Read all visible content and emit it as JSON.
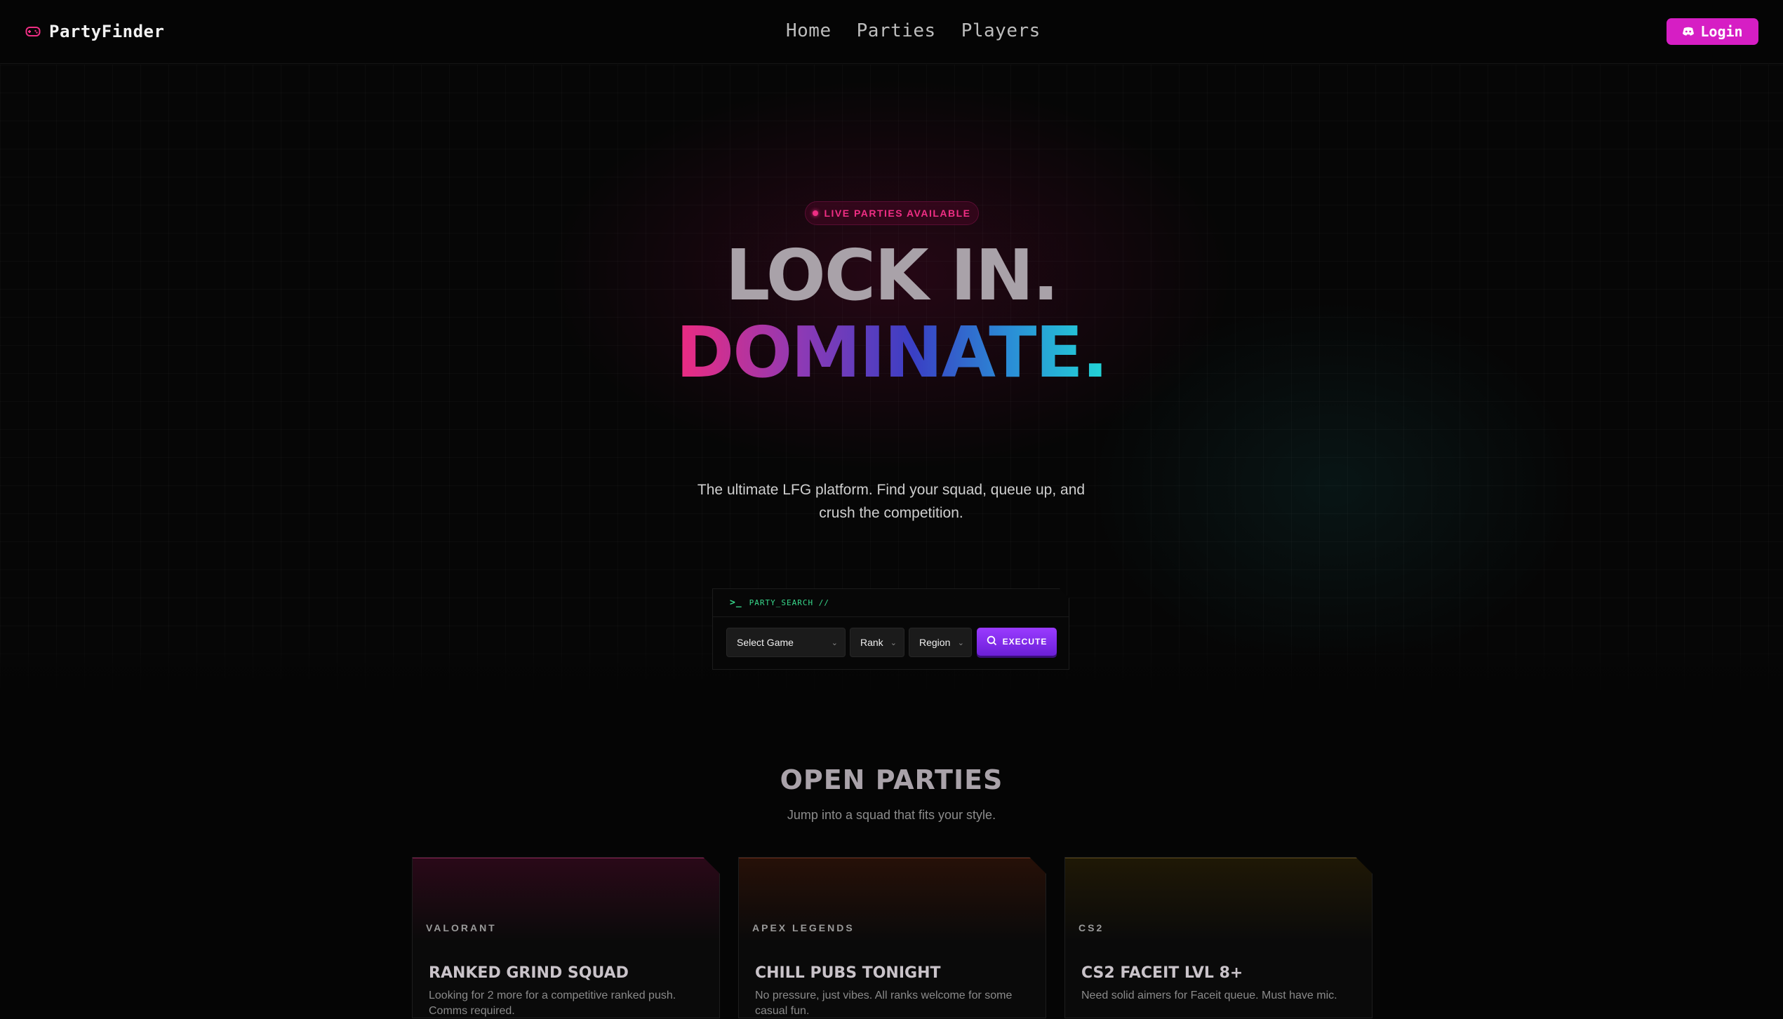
{
  "nav": {
    "brand": "PartyFinder",
    "links": [
      "Home",
      "Parties",
      "Players"
    ],
    "login_label": "Login"
  },
  "hero": {
    "badge": "LIVE PARTIES AVAILABLE",
    "headline_line1": "LOCK IN.",
    "headline_line2": "DOMINATE.",
    "subtitle": "The ultimate LFG platform. Find your squad, queue up, and crush the competition."
  },
  "search": {
    "prompt": ">_",
    "label": "PARTY_SEARCH //",
    "game_select": "Select Game",
    "rank_select": "Rank",
    "region_select": "Region",
    "execute_label": "EXECUTE"
  },
  "parties": {
    "title": "OPEN PARTIES",
    "subtitle": "Jump into a squad that fits your style.",
    "cards": [
      {
        "game": "VALORANT",
        "title": "RANKED GRIND SQUAD",
        "desc": "Looking for 2 more for a competitive ranked push. Comms required."
      },
      {
        "game": "APEX LEGENDS",
        "title": "CHILL PUBS TONIGHT",
        "desc": "No pressure, just vibes. All ranks welcome for some casual fun."
      },
      {
        "game": "CS2",
        "title": "CS2 FACEIT LVL 8+",
        "desc": "Need solid aimers for Faceit queue. Must have mic."
      }
    ]
  },
  "colors": {
    "accent_magenta": "#d61ec4",
    "accent_pink": "#ef2e84",
    "accent_green": "#38d98c",
    "accent_purple": "#8a2cf0",
    "background": "#050505"
  },
  "icons": {
    "brand": "gamepad-icon",
    "login": "discord-icon",
    "execute": "search-icon",
    "select": "chevron-down-icon"
  }
}
